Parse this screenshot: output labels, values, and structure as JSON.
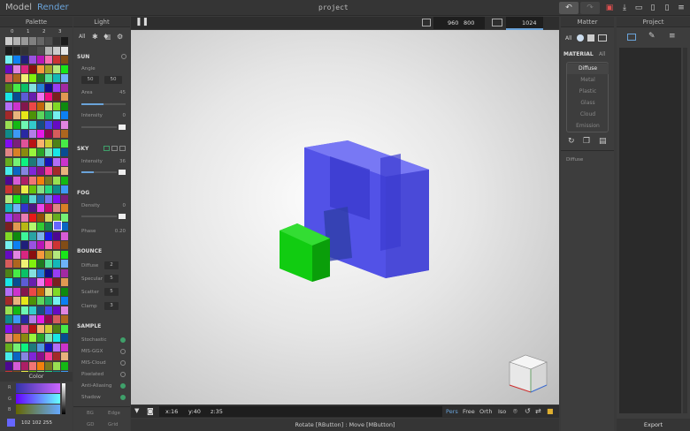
{
  "app": {
    "mode_model": "Model",
    "mode_render": "Render",
    "project_title": "project"
  },
  "toolbar": {
    "width": "960",
    "height": "800",
    "samples": "1024"
  },
  "palette": {
    "title": "Palette",
    "tabs": [
      "0",
      "1",
      "2",
      "3"
    ]
  },
  "color": {
    "title": "Color",
    "r": "R",
    "g": "G",
    "b": "B",
    "hex": "102 102 255"
  },
  "light": {
    "title": "Light",
    "all": "All",
    "sun": "SUN",
    "angle": "Angle",
    "angle_a": "50",
    "angle_b": "50",
    "area": "Area",
    "area_val": "45",
    "intensity": "Intensity",
    "intensity_val": "0",
    "sky": "SKY",
    "sky_intensity": "Intensity",
    "sky_intensity_val": "36",
    "fog": "FOG",
    "density": "Density",
    "density_val": "0",
    "phase": "Phase",
    "phase_val": "0.20",
    "bounce": "BOUNCE",
    "diffuse": "Diffuse",
    "diffuse_val": "2",
    "specular": "Specular",
    "specular_val": "5",
    "scatter": "Scatter",
    "scatter_val": "5",
    "clamp": "Clamp",
    "clamp_val": "3",
    "sample": "SAMPLE",
    "stochastic": "Stochastic",
    "mis_ggx": "MIS-GGX",
    "mis_cloud": "MIS-Cloud",
    "pixelated": "Pixelated",
    "anti_aliasing": "Anti-Aliasing",
    "shadow": "Shadow",
    "bg": "BG",
    "edge": "Edge",
    "gd": "GD",
    "grid": "Grid"
  },
  "viewport": {
    "coord_x": "x:16",
    "coord_y": "y:40",
    "coord_z": "z:35",
    "pers": "Pers",
    "free": "Free",
    "orth": "Orth",
    "iso": "Iso",
    "status": "Rotate [RButton] : Move [MButton]"
  },
  "matter": {
    "title": "Matter",
    "all": "All",
    "material": "MATERIAL",
    "material_all": "All",
    "items": [
      "Diffuse",
      "Metal",
      "Plastic",
      "Glass",
      "Cloud",
      "Emission"
    ],
    "selected": "Diffuse"
  },
  "project": {
    "title": "Project",
    "export": "Export"
  },
  "colors": {
    "accent": "#6aa3d9",
    "blue_model": "#4a4ae8",
    "green_model": "#11cc11",
    "undo_red": "#e05050"
  }
}
